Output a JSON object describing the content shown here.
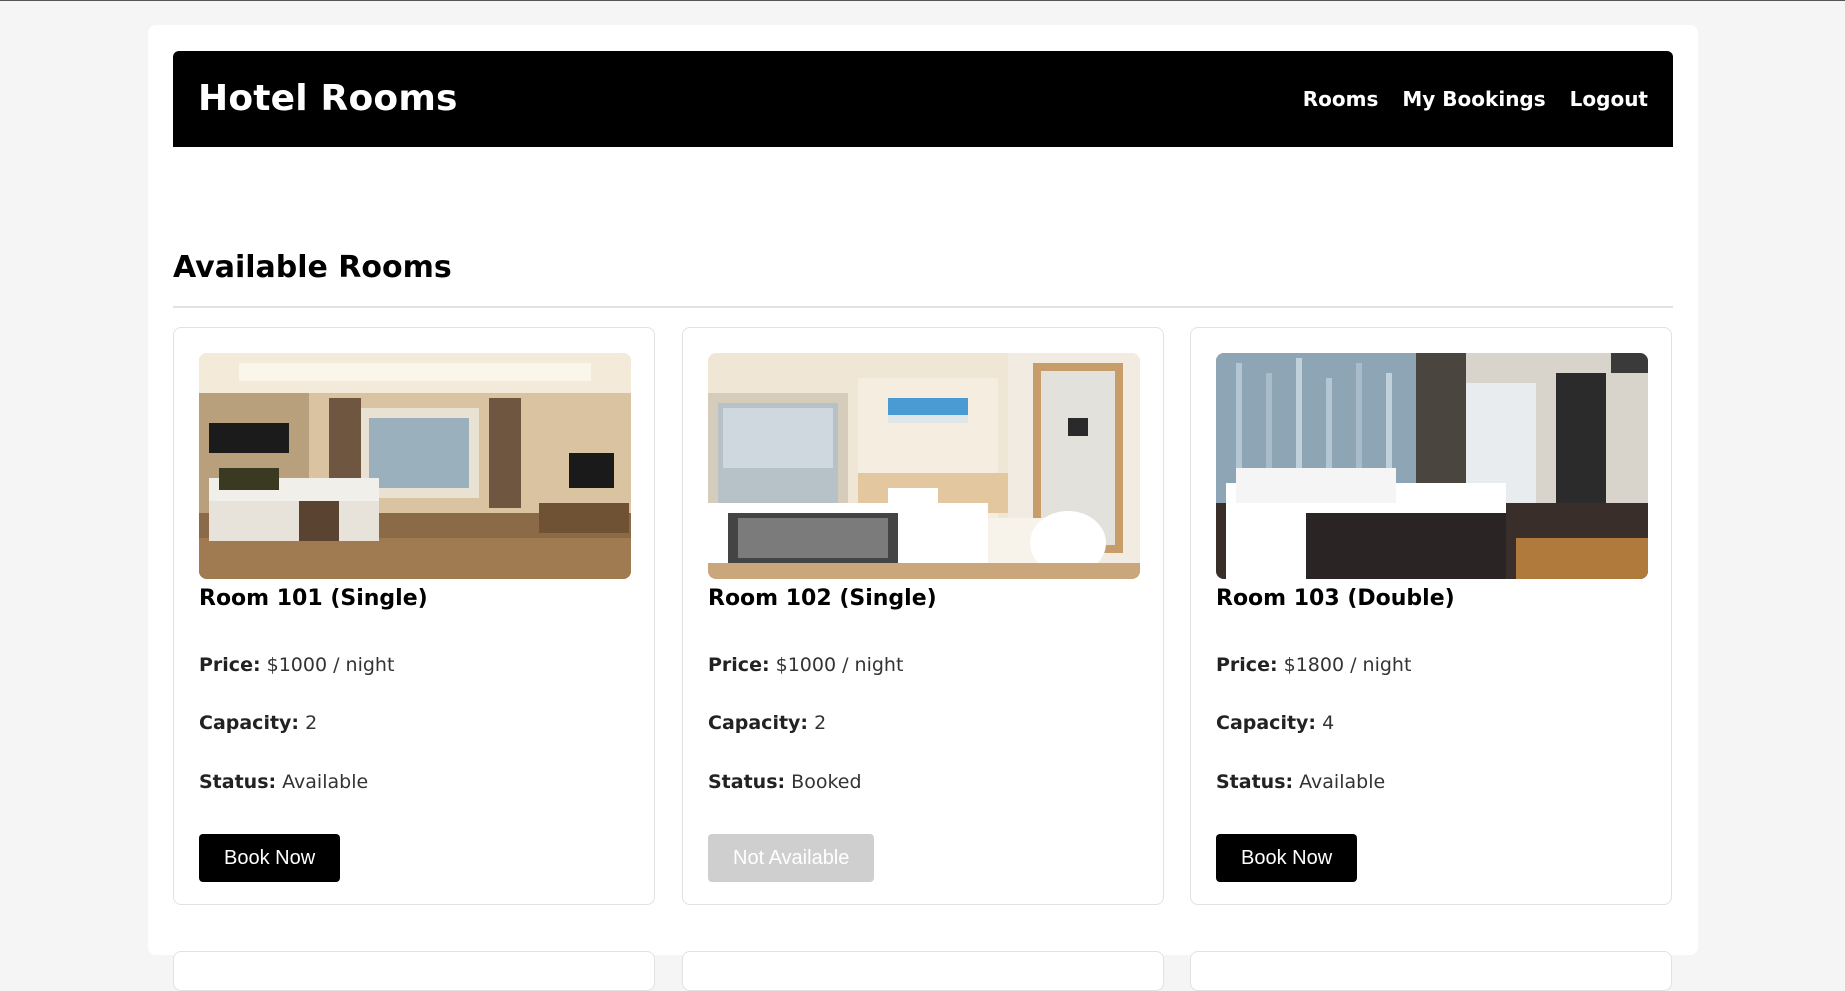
{
  "app": {
    "title": "Hotel Rooms"
  },
  "nav": {
    "rooms": "Rooms",
    "my_bookings": "My Bookings",
    "logout": "Logout"
  },
  "main": {
    "heading": "Available Rooms"
  },
  "labels": {
    "price": "Price:",
    "capacity": "Capacity:",
    "status": "Status:"
  },
  "rooms": [
    {
      "title": "Room 101 (Single)",
      "price": "$1000 / night",
      "capacity": "2",
      "status": "Available",
      "button": "Book Now"
    },
    {
      "title": "Room 102 (Single)",
      "price": "$1000 / night",
      "capacity": "2",
      "status": "Booked",
      "button": "Not Available"
    },
    {
      "title": "Room 103 (Double)",
      "price": "$1800 / night",
      "capacity": "4",
      "status": "Available",
      "button": "Book Now"
    }
  ],
  "colors": {
    "navbar": "#000000",
    "primary_button": "#000000",
    "disabled_button": "#cfcfcf",
    "page_bg": "#f5f5f5"
  }
}
